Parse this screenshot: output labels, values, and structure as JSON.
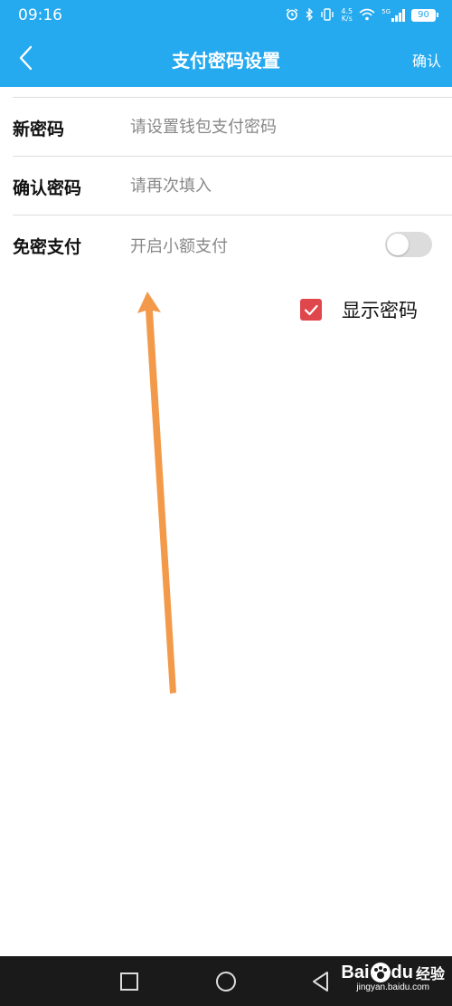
{
  "status_bar": {
    "time": "09:16",
    "net_speed_value": "4.5",
    "net_speed_unit": "K/s",
    "network_type": "5G",
    "battery_level": "90",
    "icons": [
      "alarm-icon",
      "bluetooth-icon",
      "vibrate-icon",
      "wifi-icon",
      "signal-icon",
      "battery-icon"
    ]
  },
  "title_bar": {
    "back_icon": "chevron-left-icon",
    "title": "支付密码设置",
    "confirm_label": "确认"
  },
  "form": {
    "new_password": {
      "label": "新密码",
      "placeholder": "请设置钱包支付密码"
    },
    "confirm_password": {
      "label": "确认密码",
      "placeholder": "请再次填入"
    },
    "password_free": {
      "label": "免密支付",
      "text": "开启小额支付",
      "enabled": false
    }
  },
  "show_password": {
    "label": "显示密码",
    "checked": true
  },
  "nav_bar": {
    "icons": [
      "recent-apps-icon",
      "home-icon",
      "back-icon"
    ]
  },
  "watermark": {
    "brand_prefix": "Bai",
    "brand_suffix": "du",
    "brand_cn": "经验",
    "url": "jingyan.baidu.com"
  },
  "colors": {
    "header": "#25a9ef",
    "checkbox": "#e0474c",
    "toggle_off": "#dcdcdc",
    "annotation_arrow": "#f29a4a",
    "nav_bar": "#1a1a1a"
  }
}
